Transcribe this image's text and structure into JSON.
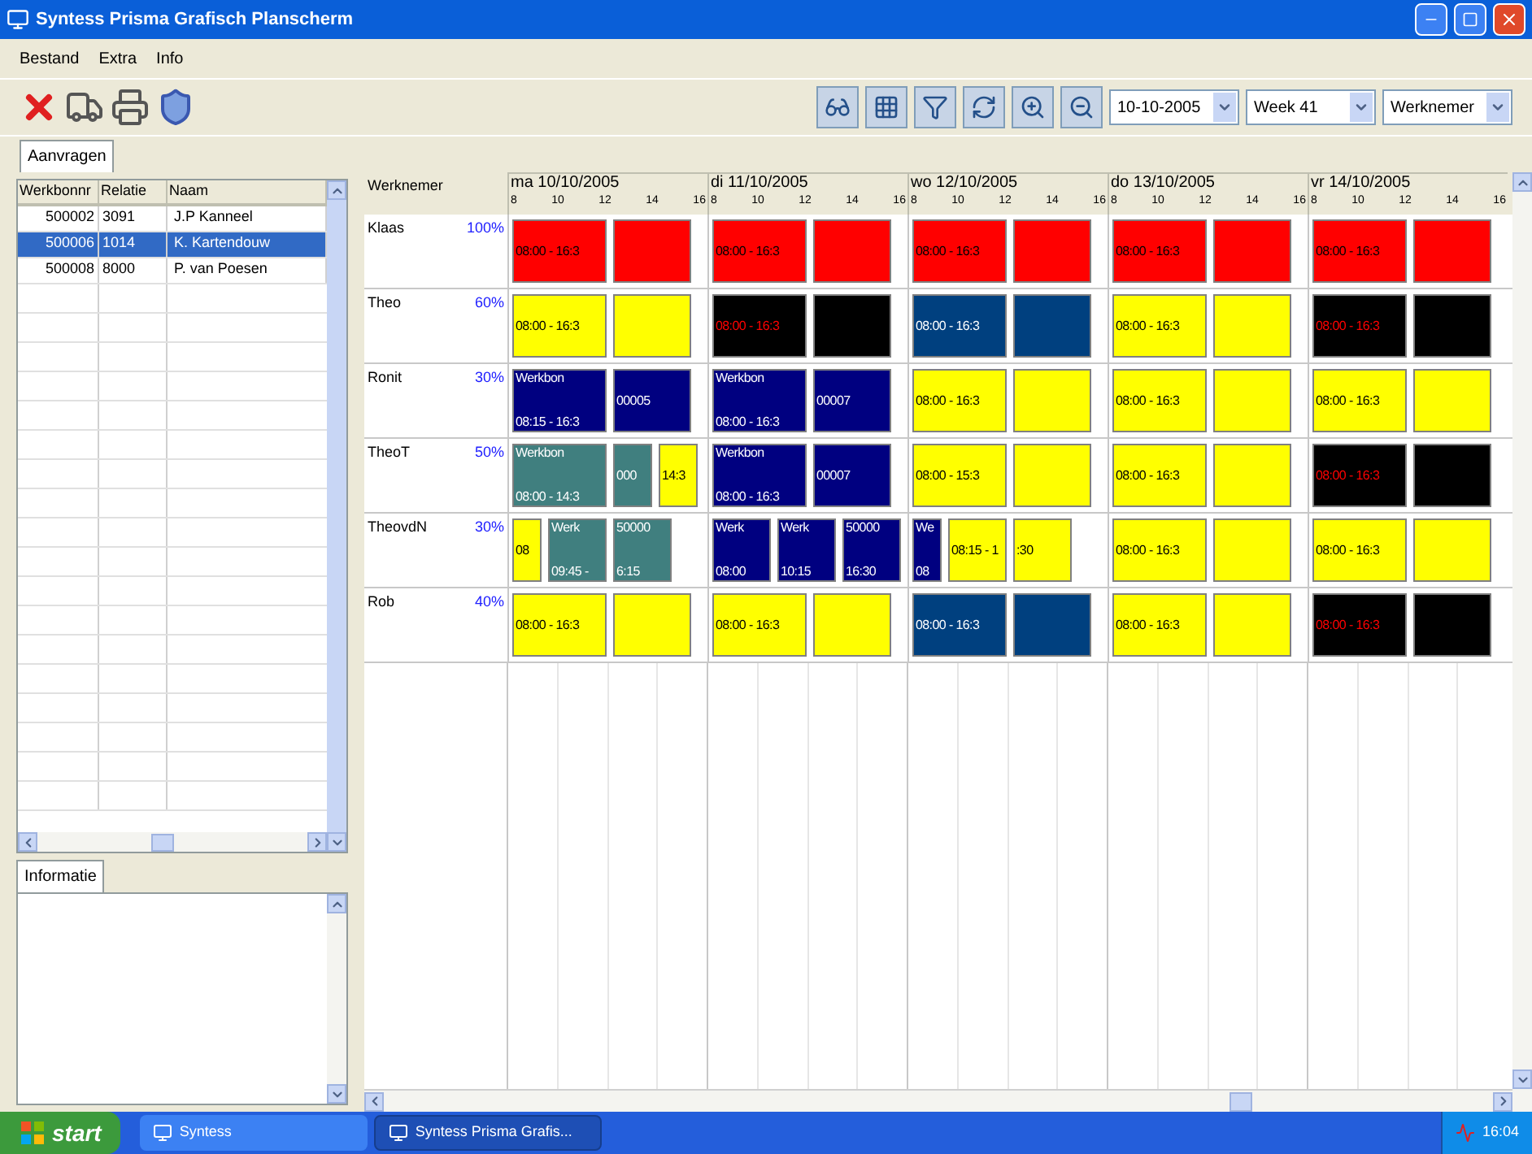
{
  "window": {
    "title": "Syntess Prisma Grafisch Planscherm"
  },
  "menu": [
    "Bestand",
    "Extra",
    "Info"
  ],
  "toolbar": {
    "date": "10-10-2005",
    "week": "Week 41",
    "view": "Werknemer"
  },
  "tabs": [
    {
      "label": "Aanvragen",
      "selected": true
    }
  ],
  "requests": {
    "columns": [
      "Werkbonnr",
      "Relatie",
      "Naam"
    ],
    "rows": [
      {
        "cells": [
          "500002",
          "3091",
          "J.P Kanneel"
        ],
        "selected": false
      },
      {
        "cells": [
          "500006",
          "1014",
          "K. Kartendouw"
        ],
        "selected": true
      },
      {
        "cells": [
          "500008",
          "8000",
          "P. van Poesen"
        ],
        "selected": false
      }
    ]
  },
  "info_tab": {
    "label": "Informatie"
  },
  "schedule": {
    "employee_header": "Werknemer",
    "days": [
      {
        "label": "ma 10/10/2005",
        "ticks": [
          "8",
          "10",
          "12",
          "14",
          "16"
        ]
      },
      {
        "label": "di 11/10/2005",
        "ticks": [
          "8",
          "10",
          "12",
          "14",
          "16"
        ]
      },
      {
        "label": "wo 12/10/2005",
        "ticks": [
          "8",
          "10",
          "12",
          "14",
          "16"
        ]
      },
      {
        "label": "do 13/10/2005",
        "ticks": [
          "8",
          "10",
          "12",
          "14",
          "16"
        ]
      },
      {
        "label": "vr 14/10/2005",
        "ticks": [
          "8",
          "10",
          "12",
          "14",
          "16"
        ]
      }
    ],
    "rows": [
      {
        "name": "Klaas",
        "load": "100%",
        "days": [
          {
            "blocks": [
              {
                "kind": "wide",
                "color": "#ff0000",
                "lines": [
                  "08:00 - 16:3"
                ]
              },
              {
                "kind": "medium",
                "color": "#ff0000"
              }
            ]
          },
          {
            "blocks": [
              {
                "kind": "wide",
                "color": "#ff0000",
                "lines": [
                  "08:00 - 16:3"
                ]
              },
              {
                "kind": "medium",
                "color": "#ff0000"
              }
            ]
          },
          {
            "blocks": [
              {
                "kind": "wide",
                "color": "#ff0000",
                "lines": [
                  "08:00 - 16:3"
                ]
              },
              {
                "kind": "medium",
                "color": "#ff0000"
              }
            ]
          },
          {
            "blocks": [
              {
                "kind": "wide",
                "color": "#ff0000",
                "lines": [
                  "08:00 - 16:3"
                ]
              },
              {
                "kind": "medium",
                "color": "#ff0000"
              }
            ]
          },
          {
            "blocks": [
              {
                "kind": "wide",
                "color": "#ff0000",
                "lines": [
                  "08:00 - 16:3"
                ]
              },
              {
                "kind": "medium",
                "color": "#ff0000"
              }
            ]
          }
        ]
      },
      {
        "name": "Theo",
        "load": "60%",
        "days": [
          {
            "blocks": [
              {
                "kind": "wide",
                "color": "#ffff00",
                "lines": [
                  "08:00 - 16:3"
                ]
              },
              {
                "kind": "medium",
                "color": "#ffff00"
              }
            ]
          },
          {
            "blocks": [
              {
                "kind": "wide",
                "color": "#000000",
                "lines": [
                  "08:00 - 16:3"
                ]
              },
              {
                "kind": "medium",
                "color": "#000000"
              }
            ]
          },
          {
            "blocks": [
              {
                "kind": "wide",
                "color": "#00407f",
                "lines": [
                  "08:00 - 16:3"
                ]
              },
              {
                "kind": "medium",
                "color": "#00407f"
              }
            ]
          },
          {
            "blocks": [
              {
                "kind": "wide",
                "color": "#ffff00",
                "lines": [
                  "08:00 - 16:3"
                ]
              },
              {
                "kind": "medium",
                "color": "#ffff00"
              }
            ]
          },
          {
            "blocks": [
              {
                "kind": "wide",
                "color": "#000000",
                "lines": [
                  "08:00 - 16:3"
                ]
              },
              {
                "kind": "medium",
                "color": "#000000"
              }
            ]
          }
        ]
      },
      {
        "name": "Ronit",
        "load": "30%",
        "days": [
          {
            "blocks": [
              {
                "kind": "wide",
                "color": "#000080",
                "lines": [
                  "Werkbon",
                  "08:15 - 16:3"
                ]
              },
              {
                "kind": "medium",
                "color": "#000080",
                "lines": [
                  "00005"
                ]
              }
            ]
          },
          {
            "blocks": [
              {
                "kind": "wide",
                "color": "#000080",
                "lines": [
                  "Werkbon",
                  "08:00 - 16:3"
                ]
              },
              {
                "kind": "medium",
                "color": "#000080",
                "lines": [
                  "00007"
                ]
              }
            ]
          },
          {
            "blocks": [
              {
                "kind": "wide",
                "color": "#ffff00",
                "lines": [
                  "08:00 - 16:3"
                ]
              },
              {
                "kind": "medium",
                "color": "#ffff00"
              }
            ]
          },
          {
            "blocks": [
              {
                "kind": "wide",
                "color": "#ffff00",
                "lines": [
                  "08:00 - 16:3"
                ]
              },
              {
                "kind": "medium",
                "color": "#ffff00"
              }
            ]
          },
          {
            "blocks": [
              {
                "kind": "wide",
                "color": "#ffff00",
                "lines": [
                  "08:00 - 16:3"
                ]
              },
              {
                "kind": "medium",
                "color": "#ffff00"
              }
            ]
          }
        ]
      },
      {
        "name": "TheoT",
        "load": "50%",
        "days": [
          {
            "blocks": [
              {
                "kind": "wide",
                "color": "#407f7f",
                "lines": [
                  "Werkbon",
                  "08:00 - 14:3"
                ]
              },
              {
                "kind": "narrow",
                "color": "#407f7f",
                "lines": [
                  "000"
                ]
              },
              {
                "kind": "narrow",
                "color": "#ffff00",
                "lines": [
                  "14:3"
                ]
              }
            ]
          },
          {
            "blocks": [
              {
                "kind": "wide",
                "color": "#000080",
                "lines": [
                  "Werkbon",
                  "08:00 - 16:3"
                ]
              },
              {
                "kind": "medium",
                "color": "#000080",
                "lines": [
                  "00007"
                ]
              }
            ]
          },
          {
            "blocks": [
              {
                "kind": "wide",
                "color": "#ffff00",
                "lines": [
                  "08:00 - 15:3"
                ]
              },
              {
                "kind": "medium",
                "color": "#ffff00"
              }
            ]
          },
          {
            "blocks": [
              {
                "kind": "wide",
                "color": "#ffff00",
                "lines": [
                  "08:00 - 16:3"
                ]
              },
              {
                "kind": "medium",
                "color": "#ffff00"
              }
            ]
          },
          {
            "blocks": [
              {
                "kind": "wide",
                "color": "#000000",
                "lines": [
                  "08:00 - 16:3"
                ]
              },
              {
                "kind": "medium",
                "color": "#000000"
              }
            ]
          }
        ]
      },
      {
        "name": "TheovdN",
        "load": "30%",
        "days": [
          {
            "blocks": [
              {
                "kind": "tiny",
                "color": "#ffff00",
                "lines": [
                  "08"
                ]
              },
              {
                "kind": "half",
                "color": "#407f7f",
                "lines": [
                  "Werk",
                  "09:45 -"
                ]
              },
              {
                "kind": "half",
                "color": "#407f7f",
                "lines": [
                  "50000",
                  "6:15"
                ]
              }
            ]
          },
          {
            "blocks": [
              {
                "kind": "half",
                "color": "#000080",
                "lines": [
                  "Werk",
                  "08:00"
                ]
              },
              {
                "kind": "half",
                "color": "#000080",
                "lines": [
                  "Werk",
                  "10:15"
                ]
              },
              {
                "kind": "half",
                "color": "#000080",
                "lines": [
                  "50000",
                  "16:30"
                ]
              }
            ]
          },
          {
            "blocks": [
              {
                "kind": "tiny",
                "color": "#000080",
                "lines": [
                  "We",
                  "08"
                ]
              },
              {
                "kind": "half",
                "color": "#ffff00",
                "lines": [
                  "08:15 - 1"
                ]
              },
              {
                "kind": "half",
                "color": "#ffff00",
                "lines": [
                  ":30"
                ]
              }
            ]
          },
          {
            "blocks": [
              {
                "kind": "wide",
                "color": "#ffff00",
                "lines": [
                  "08:00 - 16:3"
                ]
              },
              {
                "kind": "medium",
                "color": "#ffff00"
              }
            ]
          },
          {
            "blocks": [
              {
                "kind": "wide",
                "color": "#ffff00",
                "lines": [
                  "08:00 - 16:3"
                ]
              },
              {
                "kind": "medium",
                "color": "#ffff00"
              }
            ]
          }
        ]
      },
      {
        "name": "Rob",
        "load": "40%",
        "days": [
          {
            "blocks": [
              {
                "kind": "wide",
                "color": "#ffff00",
                "lines": [
                  "08:00 - 16:3"
                ]
              },
              {
                "kind": "medium",
                "color": "#ffff00"
              }
            ]
          },
          {
            "blocks": [
              {
                "kind": "wide",
                "color": "#ffff00",
                "lines": [
                  "08:00 - 16:3"
                ]
              },
              {
                "kind": "medium",
                "color": "#ffff00"
              }
            ]
          },
          {
            "blocks": [
              {
                "kind": "wide",
                "color": "#00407f",
                "lines": [
                  "08:00 - 16:3"
                ]
              },
              {
                "kind": "medium",
                "color": "#00407f"
              }
            ]
          },
          {
            "blocks": [
              {
                "kind": "wide",
                "color": "#ffff00",
                "lines": [
                  "08:00 - 16:3"
                ]
              },
              {
                "kind": "medium",
                "color": "#ffff00"
              }
            ]
          },
          {
            "blocks": [
              {
                "kind": "wide",
                "color": "#000000",
                "lines": [
                  "08:00 - 16:3"
                ]
              },
              {
                "kind": "medium",
                "color": "#000000"
              }
            ]
          }
        ]
      }
    ]
  },
  "taskbar": {
    "start": "start",
    "items": [
      {
        "label": "Syntess",
        "selected": false
      },
      {
        "label": "Syntess Prisma Grafis...",
        "selected": true
      }
    ],
    "clock": "16:04"
  }
}
